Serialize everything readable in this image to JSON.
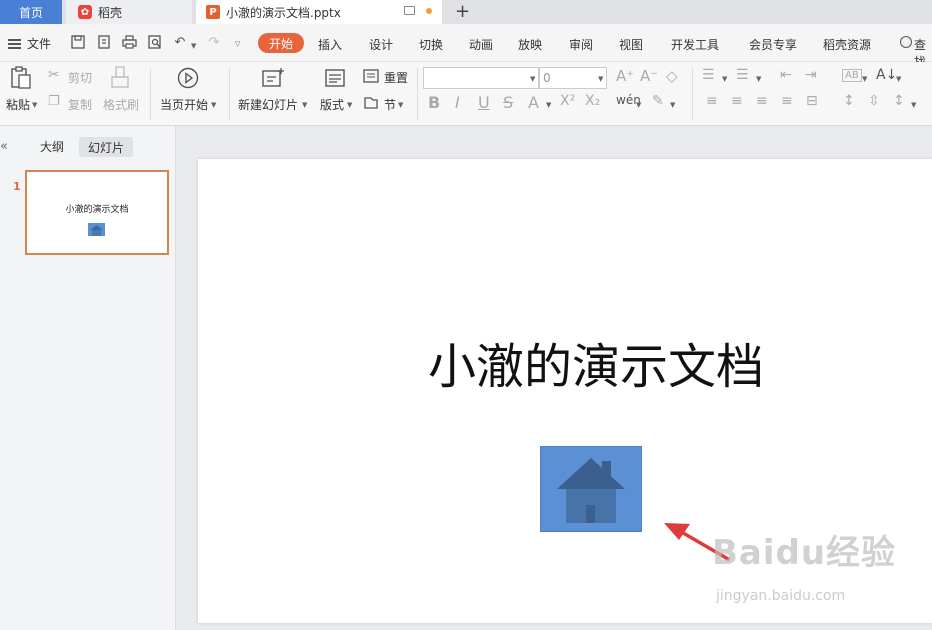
{
  "tabs": {
    "home": "首页",
    "docer": "稻壳",
    "document": "小澈的演示文档.pptx",
    "add": "+"
  },
  "menu": {
    "file": "文件",
    "start": "开始",
    "items": [
      "插入",
      "设计",
      "切换",
      "动画",
      "放映",
      "审阅",
      "视图",
      "开发工具",
      "会员专享",
      "稻壳资源"
    ],
    "search": "查找"
  },
  "ribbon": {
    "paste": "粘贴",
    "cut": "剪切",
    "copy": "复制",
    "format_painter": "格式刷",
    "play_from_current": "当页开始",
    "new_slide": "新建幻灯片",
    "layout": "版式",
    "reset": "重置",
    "section": "节",
    "font_size": "0"
  },
  "panel": {
    "outline": "大纲",
    "slides": "幻灯片",
    "slide_number": "1",
    "thumb_title": "小澈的演示文档"
  },
  "slide": {
    "title": "小澈的演示文档"
  },
  "watermark": {
    "main": "Baidu经验",
    "sub": "jingyan.baidu.com"
  },
  "colors": {
    "accent": "#e8643c",
    "home_tab": "#4a7fd6",
    "picture": "#5b91d4",
    "arrow": "#e03a3a"
  }
}
